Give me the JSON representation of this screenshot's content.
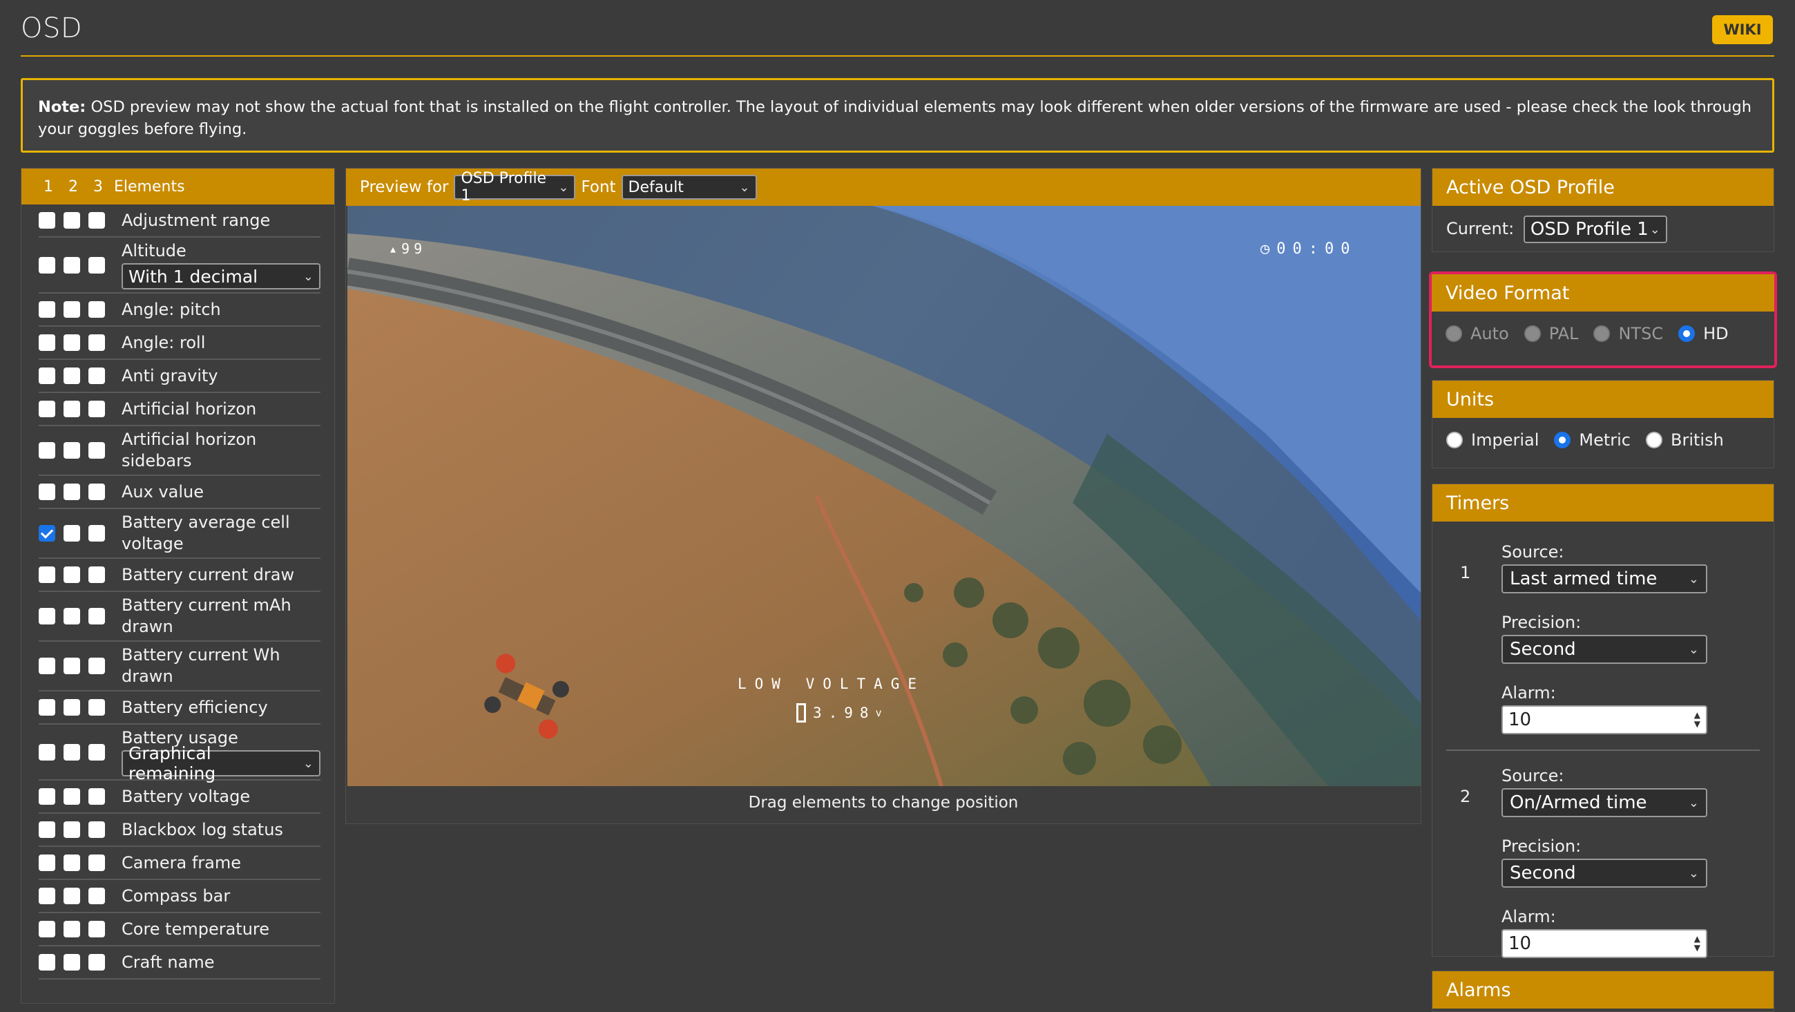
{
  "header": {
    "title": "OSD",
    "wiki_label": "WIKI"
  },
  "note": {
    "bold": "Note:",
    "text": " OSD preview may not show the actual font that is installed on the flight controller. The layout of individual elements may look different when older versions of the firmware are used - please check the look through your goggles before flying."
  },
  "elements_panel": {
    "profile_tabs": [
      "1",
      "2",
      "3"
    ],
    "title": "Elements",
    "items": [
      {
        "label": "Adjustment range",
        "checked": [
          false,
          false,
          false
        ]
      },
      {
        "label": "Altitude",
        "checked": [
          false,
          false,
          false
        ],
        "select": "With 1 decimal"
      },
      {
        "label": "Angle: pitch",
        "checked": [
          false,
          false,
          false
        ]
      },
      {
        "label": "Angle: roll",
        "checked": [
          false,
          false,
          false
        ]
      },
      {
        "label": "Anti gravity",
        "checked": [
          false,
          false,
          false
        ]
      },
      {
        "label": "Artificial horizon",
        "checked": [
          false,
          false,
          false
        ]
      },
      {
        "label": "Artificial horizon sidebars",
        "checked": [
          false,
          false,
          false
        ]
      },
      {
        "label": "Aux value",
        "checked": [
          false,
          false,
          false
        ]
      },
      {
        "label": "Battery average cell voltage",
        "checked": [
          true,
          false,
          false
        ]
      },
      {
        "label": "Battery current draw",
        "checked": [
          false,
          false,
          false
        ]
      },
      {
        "label": "Battery current mAh drawn",
        "checked": [
          false,
          false,
          false
        ]
      },
      {
        "label": "Battery current Wh drawn",
        "checked": [
          false,
          false,
          false
        ]
      },
      {
        "label": "Battery efficiency",
        "checked": [
          false,
          false,
          false
        ]
      },
      {
        "label": "Battery usage",
        "checked": [
          false,
          false,
          false
        ],
        "select": "Graphical remaining"
      },
      {
        "label": "Battery voltage",
        "checked": [
          false,
          false,
          false
        ]
      },
      {
        "label": "Blackbox log status",
        "checked": [
          false,
          false,
          false
        ]
      },
      {
        "label": "Camera frame",
        "checked": [
          false,
          false,
          false
        ]
      },
      {
        "label": "Compass bar",
        "checked": [
          false,
          false,
          false
        ]
      },
      {
        "label": "Core temperature",
        "checked": [
          false,
          false,
          false
        ]
      },
      {
        "label": "Craft name",
        "checked": [
          false,
          false,
          false
        ]
      }
    ]
  },
  "preview": {
    "preview_for_label": "Preview for",
    "profile_value": "OSD Profile 1",
    "font_label": "Font",
    "font_value": "Default",
    "osd_rssi": "99",
    "osd_timer": "00:00",
    "osd_warning": "LOW VOLTAGE",
    "osd_cell_voltage": "3.98",
    "osd_volt_unit": "v",
    "caption": "Drag elements to change position"
  },
  "active_profile": {
    "title": "Active OSD Profile",
    "current_label": "Current:",
    "current_value": "OSD Profile 1"
  },
  "video_format": {
    "title": "Video Format",
    "options": [
      {
        "label": "Auto",
        "selected": false,
        "disabled": true
      },
      {
        "label": "PAL",
        "selected": false,
        "disabled": true
      },
      {
        "label": "NTSC",
        "selected": false,
        "disabled": true
      },
      {
        "label": "HD",
        "selected": true,
        "disabled": false
      }
    ]
  },
  "units": {
    "title": "Units",
    "options": [
      {
        "label": "Imperial",
        "selected": false
      },
      {
        "label": "Metric",
        "selected": true
      },
      {
        "label": "British",
        "selected": false
      }
    ]
  },
  "timers": {
    "title": "Timers",
    "source_label": "Source:",
    "precision_label": "Precision:",
    "alarm_label": "Alarm:",
    "items": [
      {
        "num": "1",
        "source": "Last armed time",
        "precision": "Second",
        "alarm": "10"
      },
      {
        "num": "2",
        "source": "On/Armed time",
        "precision": "Second",
        "alarm": "10"
      }
    ]
  },
  "alarms": {
    "title": "Alarms"
  },
  "colors": {
    "accent": "#c98b00",
    "highlight_border": "#e0215b",
    "checkbox_on": "#1a73e8"
  }
}
